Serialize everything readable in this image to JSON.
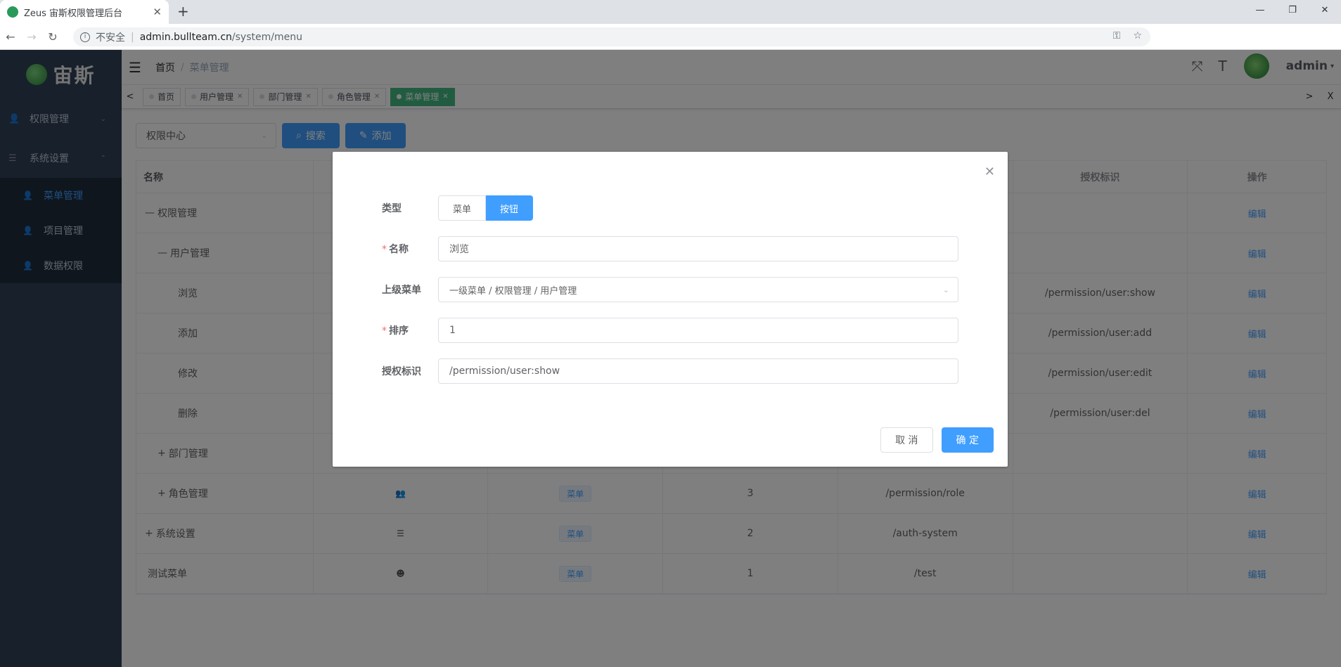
{
  "browser": {
    "tab_title": "Zeus 宙斯权限管理后台",
    "tab_close": "✕",
    "new_tab": "+",
    "window_controls": [
      "—",
      "❐",
      "✕"
    ],
    "address": {
      "insecure": "不安全",
      "host": "admin.bullteam.cn",
      "path": "/system/menu"
    }
  },
  "sidebar": {
    "logo_text": "宙斯",
    "sections": [
      {
        "label": "权限管理",
        "arrow": "⌄"
      },
      {
        "label": "系统设置",
        "arrow": "⌃"
      }
    ],
    "items": [
      {
        "label": "菜单管理",
        "active": true
      },
      {
        "label": "项目管理",
        "active": false
      },
      {
        "label": "数据权限",
        "active": false
      }
    ]
  },
  "navbar": {
    "breadcrumb_home": "首页",
    "breadcrumb_sep": "/",
    "breadcrumb_current": "菜单管理",
    "username": "admin",
    "user_arrow": "▾"
  },
  "tags": {
    "prev": "<",
    "next": ">",
    "close_all": "X",
    "items": [
      {
        "label": "首页",
        "active": false
      },
      {
        "label": "用户管理",
        "active": false
      },
      {
        "label": "部门管理",
        "active": false
      },
      {
        "label": "角色管理",
        "active": false
      },
      {
        "label": "菜单管理",
        "active": true
      }
    ]
  },
  "toolbar": {
    "select_value": "权限中心",
    "search_label": "搜索",
    "add_label": "添加"
  },
  "table": {
    "headers": [
      "名称",
      "",
      "",
      "",
      "",
      "授权标识",
      "操作"
    ],
    "rows": [
      {
        "name": "权限管理",
        "prefix": "—",
        "indent": 0,
        "icon": "",
        "type": "",
        "sort": "",
        "path": "",
        "perm": "",
        "action": "编辑"
      },
      {
        "name": "用户管理",
        "prefix": "—",
        "indent": 1,
        "icon": "",
        "type": "",
        "sort": "",
        "path": "",
        "perm": "",
        "action": "编辑"
      },
      {
        "name": "浏览",
        "prefix": "",
        "indent": 2,
        "icon": "",
        "type": "",
        "sort": "",
        "path": "",
        "perm": "/permission/user:show",
        "action": "编辑"
      },
      {
        "name": "添加",
        "prefix": "",
        "indent": 2,
        "icon": "",
        "type": "",
        "sort": "",
        "path": "",
        "perm": "/permission/user:add",
        "action": "编辑"
      },
      {
        "name": "修改",
        "prefix": "",
        "indent": 2,
        "icon": "",
        "type": "",
        "sort": "",
        "path": "",
        "perm": "/permission/user:edit",
        "action": "编辑"
      },
      {
        "name": "删除",
        "prefix": "",
        "indent": 2,
        "icon": "",
        "type": "",
        "sort": "",
        "path": "",
        "perm": "/permission/user:del",
        "action": "编辑"
      },
      {
        "name": "部门管理",
        "prefix": "+",
        "indent": 1,
        "icon": "",
        "type": "",
        "sort": "",
        "path": "",
        "perm": "",
        "action": "编辑"
      },
      {
        "name": "角色管理",
        "prefix": "+",
        "indent": 1,
        "icon": "👥",
        "type": "菜单",
        "sort": "3",
        "path": "/permission/role",
        "perm": "",
        "action": "编辑"
      },
      {
        "name": "系统设置",
        "prefix": "+",
        "indent": 0,
        "icon": "☰",
        "type": "菜单",
        "sort": "2",
        "path": "/auth-system",
        "perm": "",
        "action": "编辑"
      },
      {
        "name": "测试菜单",
        "prefix": "",
        "indent": 0,
        "icon": "☻",
        "type": "菜单",
        "sort": "1",
        "path": "/test",
        "perm": "",
        "action": "编辑"
      }
    ]
  },
  "dialog": {
    "close": "✕",
    "type_label": "类型",
    "type_options": [
      "菜单",
      "按钮"
    ],
    "type_selected": "按钮",
    "name_label": "名称",
    "name_value": "浏览",
    "parent_label": "上级菜单",
    "parent_value": "一级菜单 / 权限管理 / 用户管理",
    "sort_label": "排序",
    "sort_value": "1",
    "perm_label": "授权标识",
    "perm_value": "/permission/user:show",
    "cancel_label": "取 消",
    "ok_label": "确 定",
    "required_mark": "*"
  },
  "colors": {
    "primary": "#409eff",
    "sidebar": "#304156",
    "active_tag": "#42b983",
    "required": "#f56c6c"
  }
}
